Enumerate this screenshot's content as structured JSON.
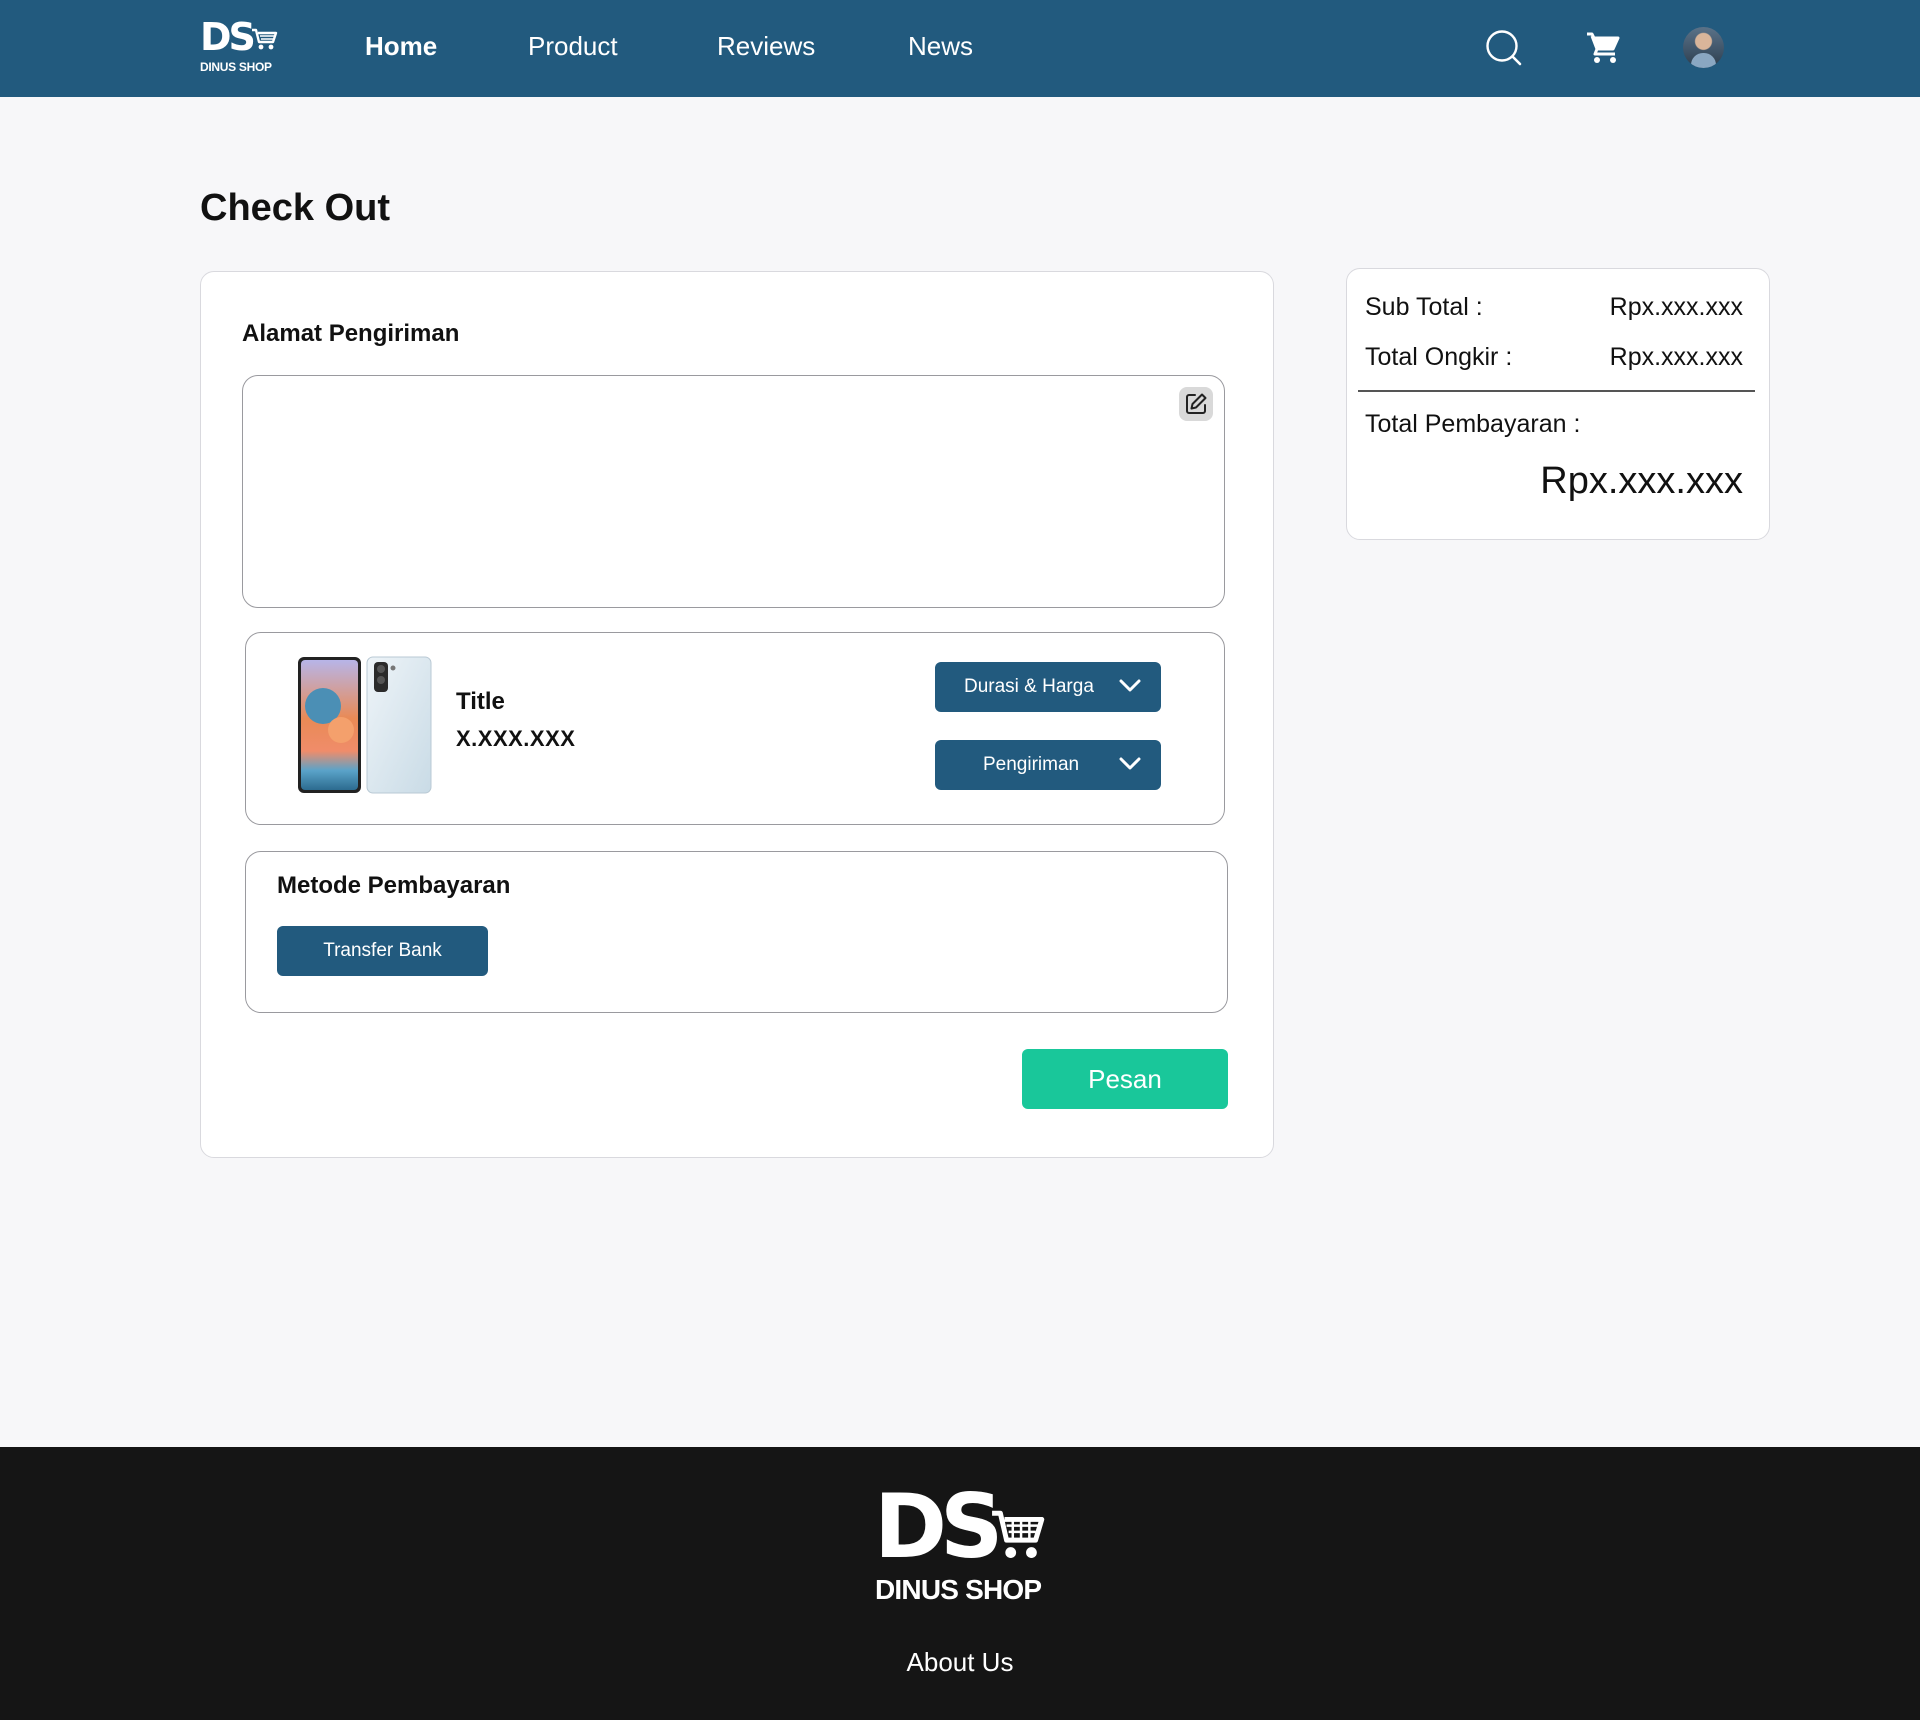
{
  "brand": {
    "logo_letters": "DS",
    "name": "DINUS SHOP",
    "header_color": "#225a7e",
    "accent_color": "#19c79a",
    "footer_color": "#151515"
  },
  "nav": {
    "items": [
      {
        "label": "Home",
        "active": true
      },
      {
        "label": "Product",
        "active": false
      },
      {
        "label": "Reviews",
        "active": false
      },
      {
        "label": "News",
        "active": false
      }
    ],
    "icons": [
      "search-icon",
      "cart-icon",
      "avatar"
    ]
  },
  "page": {
    "title": "Check Out"
  },
  "shipping": {
    "section_label": "Alamat Pengiriman",
    "address_value": "",
    "edit_icon": "edit-icon"
  },
  "product": {
    "title": "Title",
    "price": "X.XXX.XXX",
    "duration_dropdown": "Durasi & Harga",
    "shipping_dropdown": "Pengiriman"
  },
  "payment": {
    "section_label": "Metode Pembayaran",
    "method_button": "Transfer Bank"
  },
  "order": {
    "button_label": "Pesan"
  },
  "summary": {
    "subtotal_label": "Sub Total :",
    "subtotal_value": "Rpx.xxx.xxx",
    "shipping_label": "Total Ongkir :",
    "shipping_value": "Rpx.xxx.xxx",
    "total_label": "Total Pembayaran :",
    "total_value": "Rpx.xxx.xxx"
  },
  "footer": {
    "about_link": "About Us"
  }
}
